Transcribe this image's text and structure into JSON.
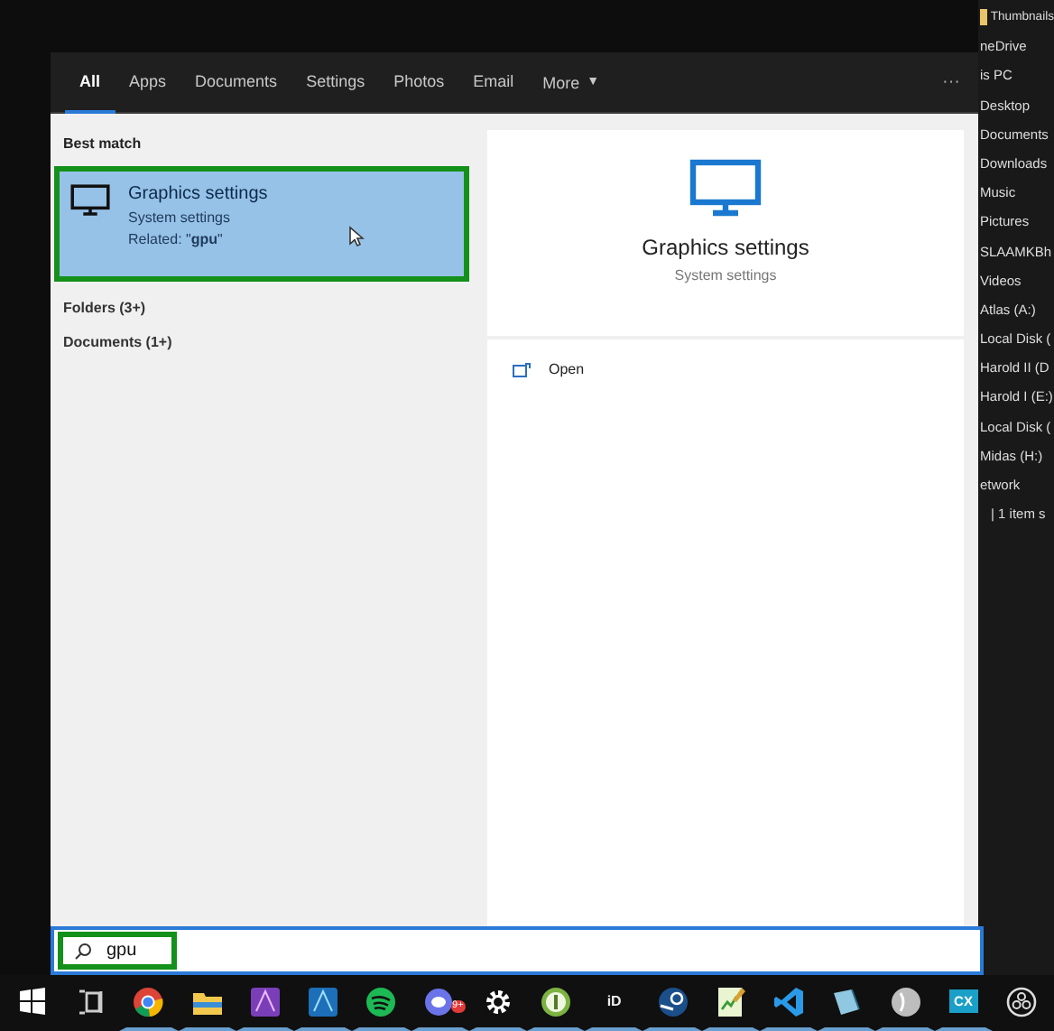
{
  "tabs": [
    {
      "label": "All",
      "selected": true
    },
    {
      "label": "Apps",
      "selected": false
    },
    {
      "label": "Documents",
      "selected": false
    },
    {
      "label": "Settings",
      "selected": false
    },
    {
      "label": "Photos",
      "selected": false
    },
    {
      "label": "Email",
      "selected": false
    }
  ],
  "more_tab": {
    "label": "More",
    "caret": "▼"
  },
  "options_button": "···",
  "best_match": {
    "heading": "Best match",
    "title": "Graphics settings",
    "subtitle": "System settings",
    "related": "Related: \"**gpu**\"",
    "highlighted": true
  },
  "groups": [
    "Folders (3+)",
    "Documents (1+)"
  ],
  "preview": {
    "title": "Graphics settings",
    "subtitle": "System settings",
    "actions": [
      "Open"
    ]
  },
  "search": {
    "value": "gpu",
    "highlighted": true
  },
  "explorer_items": [
    "Thumbnails",
    "neDrive",
    "is PC",
    "Desktop",
    "Documents",
    "Downloads",
    "Music",
    "Pictures",
    "SLAAMKBh",
    "Videos",
    "Atlas (A:)",
    "Local Disk (",
    "Harold II (D",
    "Harold I (E:)",
    "Local Disk (",
    "Midas (H:)",
    "etwork"
  ],
  "explorer_status": "| 1 item s",
  "taskbar": [
    {
      "kind": "start",
      "running": false
    },
    {
      "kind": "taskview",
      "running": false
    },
    {
      "kind": "chrome",
      "running": true
    },
    {
      "kind": "folder",
      "running": true
    },
    {
      "kind": "photo",
      "running": true
    },
    {
      "kind": "designer",
      "running": true
    },
    {
      "kind": "spotify",
      "running": true
    },
    {
      "kind": "chat",
      "running": true,
      "badge": "9+"
    },
    {
      "kind": "gear",
      "running": true
    },
    {
      "kind": "greenball",
      "running": true
    },
    {
      "kind": "text",
      "running": true,
      "text": "iD"
    },
    {
      "kind": "steam",
      "running": true
    },
    {
      "kind": "notepad",
      "running": true
    },
    {
      "kind": "code",
      "running": true
    },
    {
      "kind": "box",
      "running": true
    },
    {
      "kind": "shield",
      "running": true
    },
    {
      "kind": "textbox",
      "running": true,
      "text": "CX"
    },
    {
      "kind": "obs",
      "running": false
    }
  ]
}
